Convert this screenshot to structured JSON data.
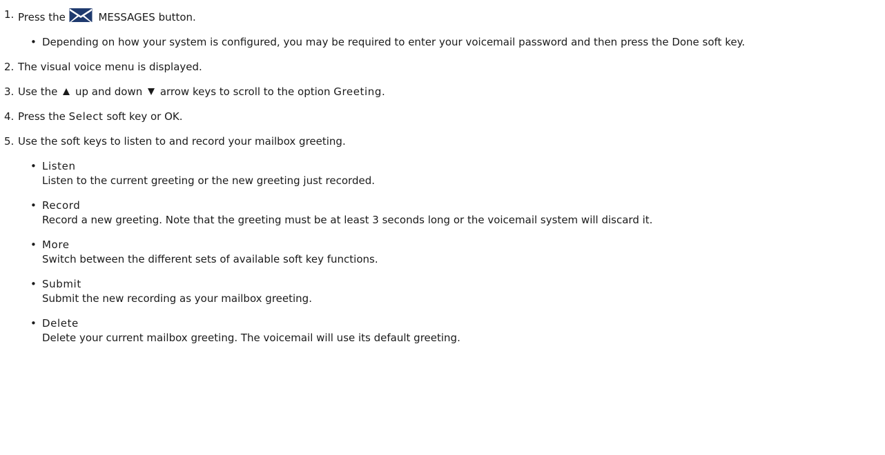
{
  "steps": [
    {
      "num": "1.",
      "pre": "Press the",
      "icon": "messages-envelope-icon",
      "post": "MESSAGES button.",
      "sub": [
        {
          "text": "Depending on how your system is configured, you may be required to enter your voicemail password and then press the Done soft key."
        }
      ]
    },
    {
      "num": "2.",
      "text": "The visual voice menu is displayed."
    },
    {
      "num": "3.",
      "pre": "Use the",
      "up_icon": "up-arrow-icon",
      "mid": "up and down",
      "down_icon": "down-arrow-icon",
      "post": "arrow keys to scroll to the option",
      "keyword": "Greeting",
      "end": "."
    },
    {
      "num": "4.",
      "pre": "Press the",
      "keyword": "Select",
      "post": "soft key or OK."
    },
    {
      "num": "5.",
      "text": "Use the soft keys to listen to and record your mailbox greeting.",
      "sub": [
        {
          "title": "Listen",
          "desc": "Listen to the current greeting or the new greeting just recorded."
        },
        {
          "title": "Record",
          "desc": "Record a new greeting. Note that the greeting must be at least 3 seconds long or the voicemail system will discard it."
        },
        {
          "title": "More",
          "desc": "Switch between the different sets of available soft key functions."
        },
        {
          "title": "Submit",
          "desc": "Submit the new recording as your mailbox greeting."
        },
        {
          "title": "Delete",
          "desc": "Delete your current mailbox greeting. The voicemail will use its default greeting."
        }
      ]
    }
  ],
  "bullet_char": "•",
  "colors": {
    "text": "#1a1a1a",
    "icon": "#1f3a6e"
  }
}
